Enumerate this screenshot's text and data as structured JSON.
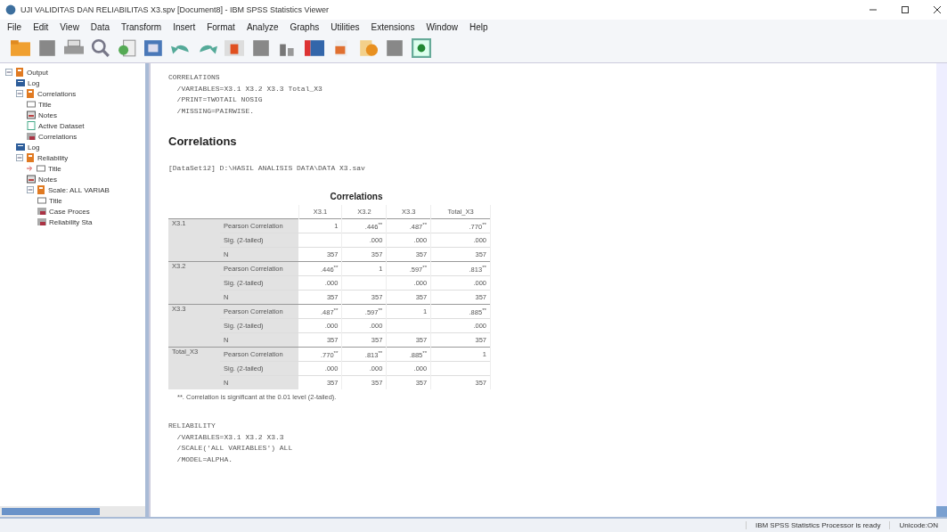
{
  "window": {
    "title": "UJI VALIDITAS DAN RELIABILITAS X3.spv [Document8] - IBM SPSS Statistics Viewer"
  },
  "menu": [
    "File",
    "Edit",
    "View",
    "Data",
    "Transform",
    "Insert",
    "Format",
    "Analyze",
    "Graphs",
    "Utilities",
    "Extensions",
    "Window",
    "Help"
  ],
  "outline": [
    {
      "label": "Output",
      "kind": "book",
      "expanded": true,
      "children": [
        {
          "label": "Log",
          "kind": "log"
        },
        {
          "label": "Correlations",
          "kind": "book",
          "expanded": true,
          "children": [
            {
              "label": "Title",
              "kind": "title"
            },
            {
              "label": "Notes",
              "kind": "notes"
            },
            {
              "label": "Active Dataset",
              "kind": "dataset"
            },
            {
              "label": "Correlations",
              "kind": "table"
            }
          ]
        },
        {
          "label": "Log",
          "kind": "log"
        },
        {
          "label": "Reliability",
          "kind": "book",
          "expanded": true,
          "children": [
            {
              "label": "Title",
              "kind": "title",
              "current": true
            },
            {
              "label": "Notes",
              "kind": "notes"
            },
            {
              "label": "Scale: ALL VARIAB",
              "kind": "book",
              "expanded": true,
              "children": [
                {
                  "label": "Title",
                  "kind": "title"
                },
                {
                  "label": "Case Proces",
                  "kind": "table"
                },
                {
                  "label": "Reliability Sta",
                  "kind": "table"
                }
              ]
            }
          ]
        }
      ]
    }
  ],
  "content": [
    {
      "kind": "syntax",
      "lines": [
        "CORRELATIONS",
        "  /VARIABLES=X3.1 X3.2 X3.3 Total_X3",
        "  /PRINT=TWOTAIL NOSIG",
        "  /MISSING=PAIRWISE."
      ]
    },
    {
      "kind": "heading",
      "text": "Correlations"
    },
    {
      "kind": "dataset",
      "text": "[DataSet12] D:\\HASIL ANALISIS DATA\\DATA X3.sav"
    },
    {
      "kind": "table",
      "title": "Correlations",
      "columns": [
        "X3.1",
        "X3.2",
        "X3.3",
        "Total_X3"
      ],
      "groups": [
        {
          "label": "X3.1",
          "rows": [
            {
              "stat": "Pearson Correlation",
              "values": {
                "column_1": "1",
                "column_2": ".446$^{**}$",
                "column_3": ".487$^{**}$",
                "column_4": ".770$^{**}$"
              }
            },
            {
              "stat": "Sig. (2-tailed)",
              "values": {
                "column_2": ".000",
                "column_3": ".000",
                "column_4": ".000"
              }
            },
            {
              "stat": "N",
              "values": {
                "column_1": "357",
                "column_2": "357",
                "column_3": "357",
                "column_4": "357"
              }
            }
          ]
        },
        {
          "label": "X3.2",
          "rows": [
            {
              "stat": "Pearson Correlation",
              "values": {
                "column_1": ".446$^{**}$",
                "column_2": "1",
                "column_3": ".597$^{**}$",
                "column_4": ".813$^{**}$"
              }
            },
            {
              "stat": "Sig. (2-tailed)",
              "values": {
                "column_1": ".000",
                "column_3": ".000",
                "column_4": ".000"
              }
            },
            {
              "stat": "N",
              "values": {
                "column_1": "357",
                "column_2": "357",
                "column_3": "357",
                "column_4": "357"
              }
            }
          ]
        },
        {
          "label": "X3.3",
          "rows": [
            {
              "stat": "Pearson Correlation",
              "values": {
                "column_1": ".487$^{**}$",
                "column_2": ".597$^{**}$",
                "column_3": "1",
                "column_4": ".885$^{**}$"
              }
            },
            {
              "stat": "Sig. (2-tailed)",
              "values": {
                "column_1": ".000",
                "column_2": ".000",
                "column_4": ".000"
              }
            },
            {
              "stat": "N",
              "values": {
                "column_1": "357",
                "column_2": "357",
                "column_3": "357",
                "column_4": "357"
              }
            }
          ]
        },
        {
          "label": "Total_X3",
          "rows": [
            {
              "stat": "Pearson Correlation",
              "values": {
                "column_1": ".770$^{**}$",
                "column_2": ".813$^{**}$",
                "column_3": ".885$^{**}$",
                "column_4": "1"
              }
            },
            {
              "stat": "Sig. (2-tailed)",
              "values": {
                "column_1": ".000",
                "column_2": ".000",
                "column_3": ".000"
              }
            },
            {
              "stat": "N",
              "values": {
                "column_1": "357",
                "column_2": "357",
                "column_3": "357",
                "column_4": "357"
              }
            }
          ]
        }
      ],
      "footnote": "**. Correlation is significant at the 0.01 level (2-tailed)."
    },
    {
      "kind": "syntax",
      "lines": [
        "RELIABILITY",
        "  /VARIABLES=X3.1 X3.2 X3.3",
        "  /SCALE('ALL VARIABLES') ALL",
        "  /MODEL=ALPHA."
      ]
    }
  ],
  "status_bar": [
    "IBM SPSS Statistics Processor is ready",
    "Unicode:ON"
  ]
}
